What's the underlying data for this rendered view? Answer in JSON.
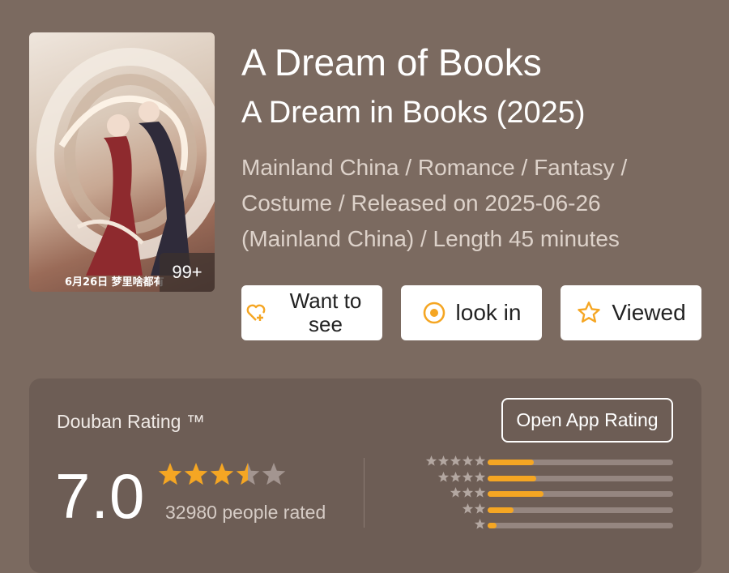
{
  "poster": {
    "badge": "99+",
    "caption": "6月26日 梦里啥都有"
  },
  "title": "A Dream of Books",
  "subtitle": "A Dream in Books (2025)",
  "meta_lines": [
    "Mainland China / Romance / Fantasy /",
    "Costume / Released on 2025-06-26",
    "(Mainland China) / Length 45 minutes"
  ],
  "buttons": {
    "want_line1": "Want to",
    "want_line2": "see",
    "look": "look in",
    "viewed": "Viewed"
  },
  "rating": {
    "label": "Douban Rating ™",
    "open_app": "Open App Rating",
    "score": "7.0",
    "stars_filled": 3.5,
    "stars_total": 5,
    "people": "32980 people rated",
    "distribution": [
      {
        "stars": 5,
        "fraction": 0.25
      },
      {
        "stars": 4,
        "fraction": 0.26
      },
      {
        "stars": 3,
        "fraction": 0.3
      },
      {
        "stars": 2,
        "fraction": 0.14
      },
      {
        "stars": 1,
        "fraction": 0.05
      }
    ]
  },
  "colors": {
    "background": "#7b6a60",
    "accent": "#f5a623",
    "card": "#6d5d55"
  }
}
